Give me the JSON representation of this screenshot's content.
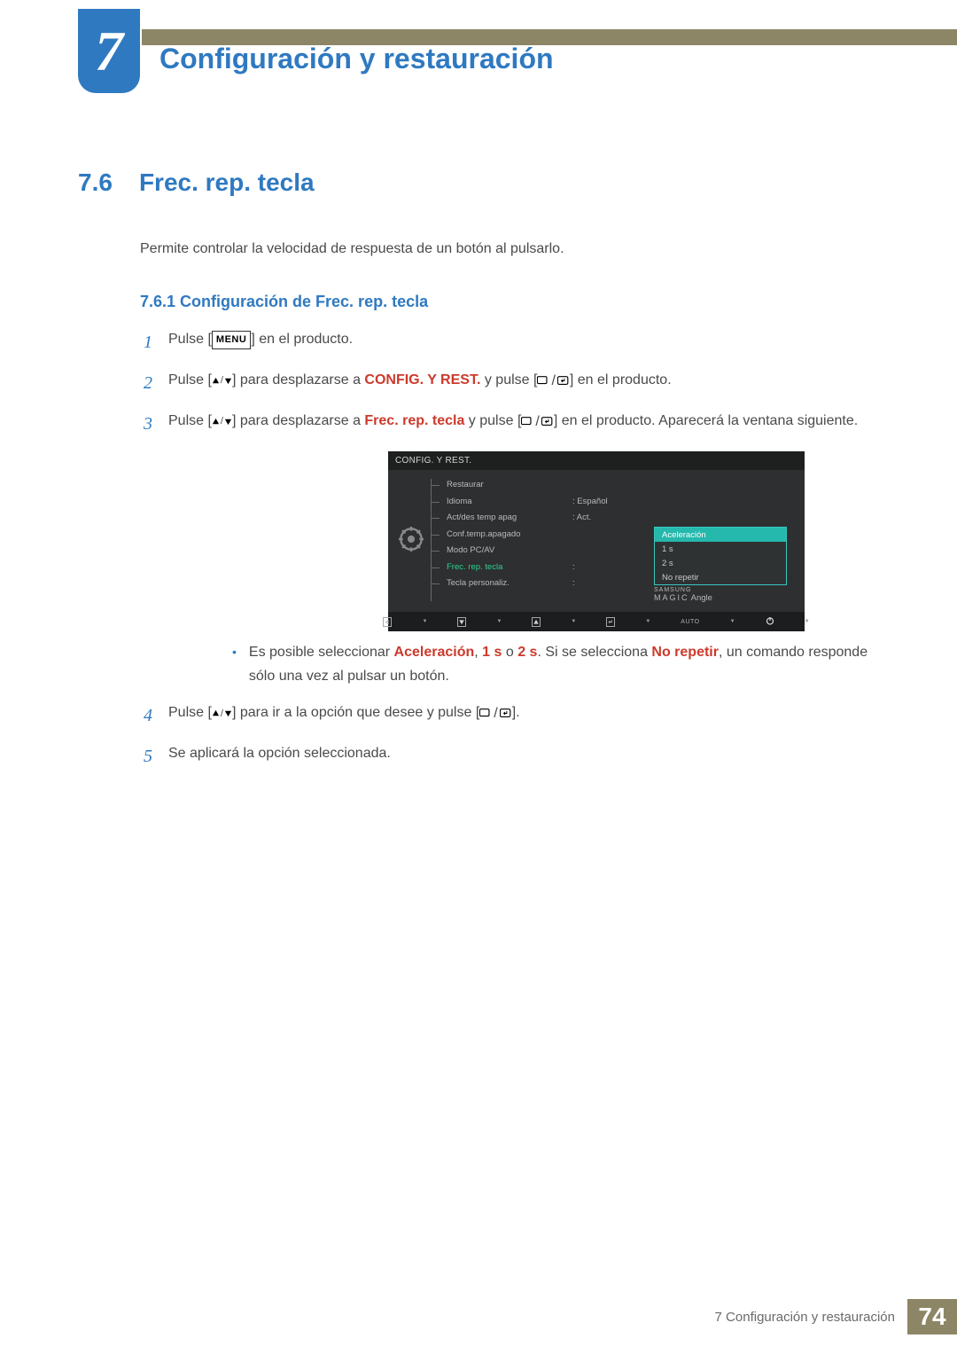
{
  "chapter": {
    "num": "7",
    "title": "Configuración y restauración"
  },
  "section": {
    "num": "7.6",
    "title": "Frec. rep. tecla"
  },
  "intro": "Permite controlar la velocidad de respuesta de un botón al pulsarlo.",
  "subsection": "7.6.1   Configuración de Frec. rep. tecla",
  "steps": {
    "s1": {
      "n": "1",
      "a": "Pulse [",
      "b": "] en el producto.",
      "menu": "MENU"
    },
    "s2": {
      "n": "2",
      "a": "Pulse [",
      "b": "] para desplazarse a ",
      "c": " y pulse [",
      "d": "] en el producto.",
      "dst": "CONFIG. Y REST."
    },
    "s3": {
      "n": "3",
      "a": "Pulse [",
      "b": "] para desplazarse a ",
      "c": " y pulse [",
      "d": "] en el producto. Aparecerá la ventana siguiente.",
      "dst": "Frec. rep. tecla"
    },
    "s4": {
      "n": "4",
      "a": "Pulse [",
      "b": "] para ir a la opción que desee y pulse [",
      "c": "]."
    },
    "s5": {
      "n": "5",
      "a": "Se aplicará la opción seleccionada."
    }
  },
  "bullet": {
    "a": "Es posible seleccionar ",
    "opt1": "Aceleración",
    "sep1": ", ",
    "opt2": "1 s",
    "sep2": " o ",
    "opt3": "2 s",
    "b": ". Si se selecciona ",
    "opt4": "No repetir",
    "c": ", un comando responde sólo una vez al pulsar un botón."
  },
  "osd": {
    "title": "CONFIG. Y REST.",
    "menu": {
      "m0": "Restaurar",
      "m1": "Idioma",
      "m2": "Act/des temp apag",
      "m3": "Conf.temp.apagado",
      "m4": "Modo PC/AV",
      "m5": "Frec. rep. tecla",
      "m6": "Tecla personaliz."
    },
    "vals": {
      "v1": ":  Español",
      "v2": ":  Act.",
      "v5": ":",
      "colon": ":"
    },
    "dropdown": {
      "d0": "Aceleración",
      "d1": "1 s",
      "d2": "2 s",
      "d3": "No repetir"
    },
    "magic": {
      "brand": "SAMSUNG",
      "word": "MAGIC",
      "angle": " Angle"
    },
    "auto": "AUTO"
  },
  "footer": {
    "text": "7 Configuración y restauración",
    "page": "74"
  }
}
